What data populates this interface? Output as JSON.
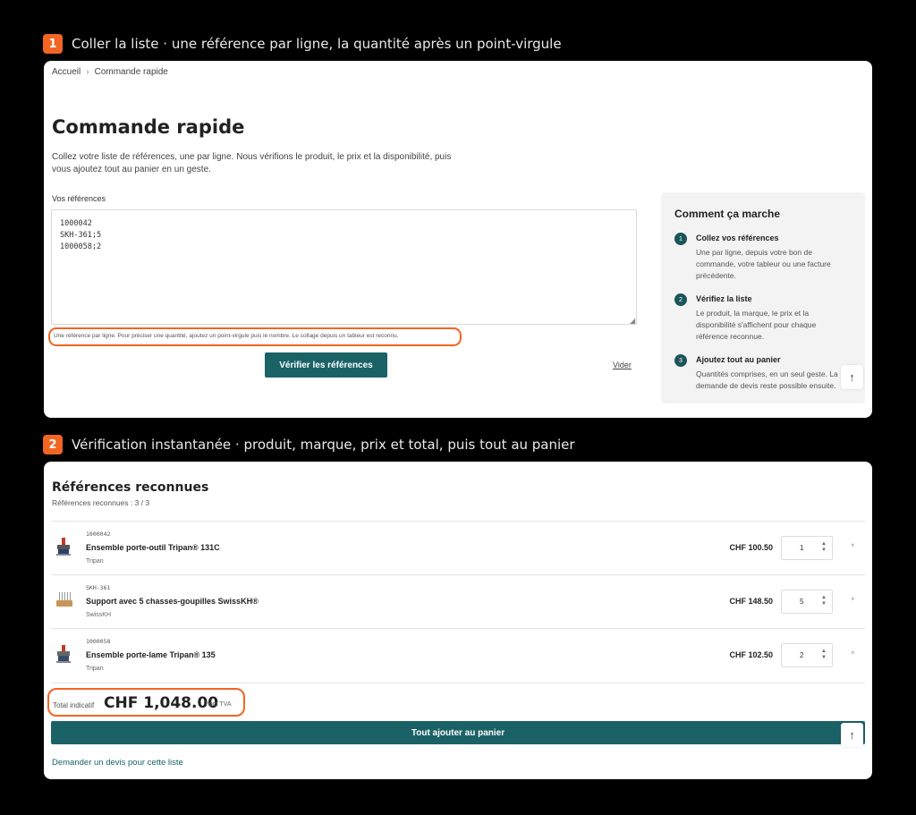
{
  "steps": [
    {
      "number": "1",
      "text": "Coller la liste · une référence par ligne, la quantité après un point-virgule"
    },
    {
      "number": "2",
      "text": "Vérification instantanée · produit, marque, prix et total, puis tout au panier"
    }
  ],
  "breadcrumb": {
    "home": "Accueil",
    "separator": "›",
    "current": "Commande rapide"
  },
  "page": {
    "title": "Commande rapide",
    "intro": "Collez votre liste de références, une par ligne. Nous vérifions le produit, le prix et la disponibilité, puis vous ajoutez tout au panier en un geste.",
    "refs_label": "Vos références",
    "refs_value": "1000042\nSKH-361;5\n1000058;2",
    "hint": "Une référence par ligne. Pour préciser une quantité, ajoutez un point-virgule puis le nombre. Le collage depuis un tableur est reconnu.",
    "verify_label": "Vérifier les références",
    "clear_label": "Vider"
  },
  "how": {
    "title": "Comment ça marche",
    "steps": [
      {
        "num": "1",
        "title": "Collez vos références",
        "text": "Une par ligne, depuis votre bon de commande, votre tableur ou une facture précédente."
      },
      {
        "num": "2",
        "title": "Vérifiez la liste",
        "text": "Le produit, la marque, le prix et la disponibilité s'affichent pour chaque référence reconnue."
      },
      {
        "num": "3",
        "title": "Ajoutez tout au panier",
        "text": "Quantités comprises, en un seul geste. La demande de devis reste possible ensuite."
      }
    ]
  },
  "scroll_top": "↑",
  "results": {
    "title": "Références reconnues",
    "count": "Références reconnues : 3 / 3",
    "items": [
      {
        "sku": "1000042",
        "name": "Ensemble porte-outil Tripan® 131C",
        "brand": "Tripan",
        "price": "CHF 100.50",
        "qty": "1",
        "icon": "tool-holder-icon"
      },
      {
        "sku": "SKH-361",
        "name": "Support avec 5 chasses-goupilles SwissKH®",
        "brand": "SwissKH",
        "price": "CHF 148.50",
        "qty": "5",
        "icon": "pin-punch-set-icon"
      },
      {
        "sku": "1000058",
        "name": "Ensemble porte-lame Tripan® 135",
        "brand": "Tripan",
        "price": "CHF 102.50",
        "qty": "2",
        "icon": "blade-holder-icon"
      }
    ],
    "remove": "×",
    "spin_up": "▲",
    "spin_down": "▼",
    "total_label": "Total indicatif",
    "total_value": "CHF 1,048.00",
    "total_tax": "hors TVA",
    "add_all_label": "Tout ajouter au panier",
    "quote_label": "Demander un devis pour cette liste"
  },
  "colors": {
    "accent": "#f26522",
    "primary": "#1a6266",
    "background": "#000000"
  }
}
